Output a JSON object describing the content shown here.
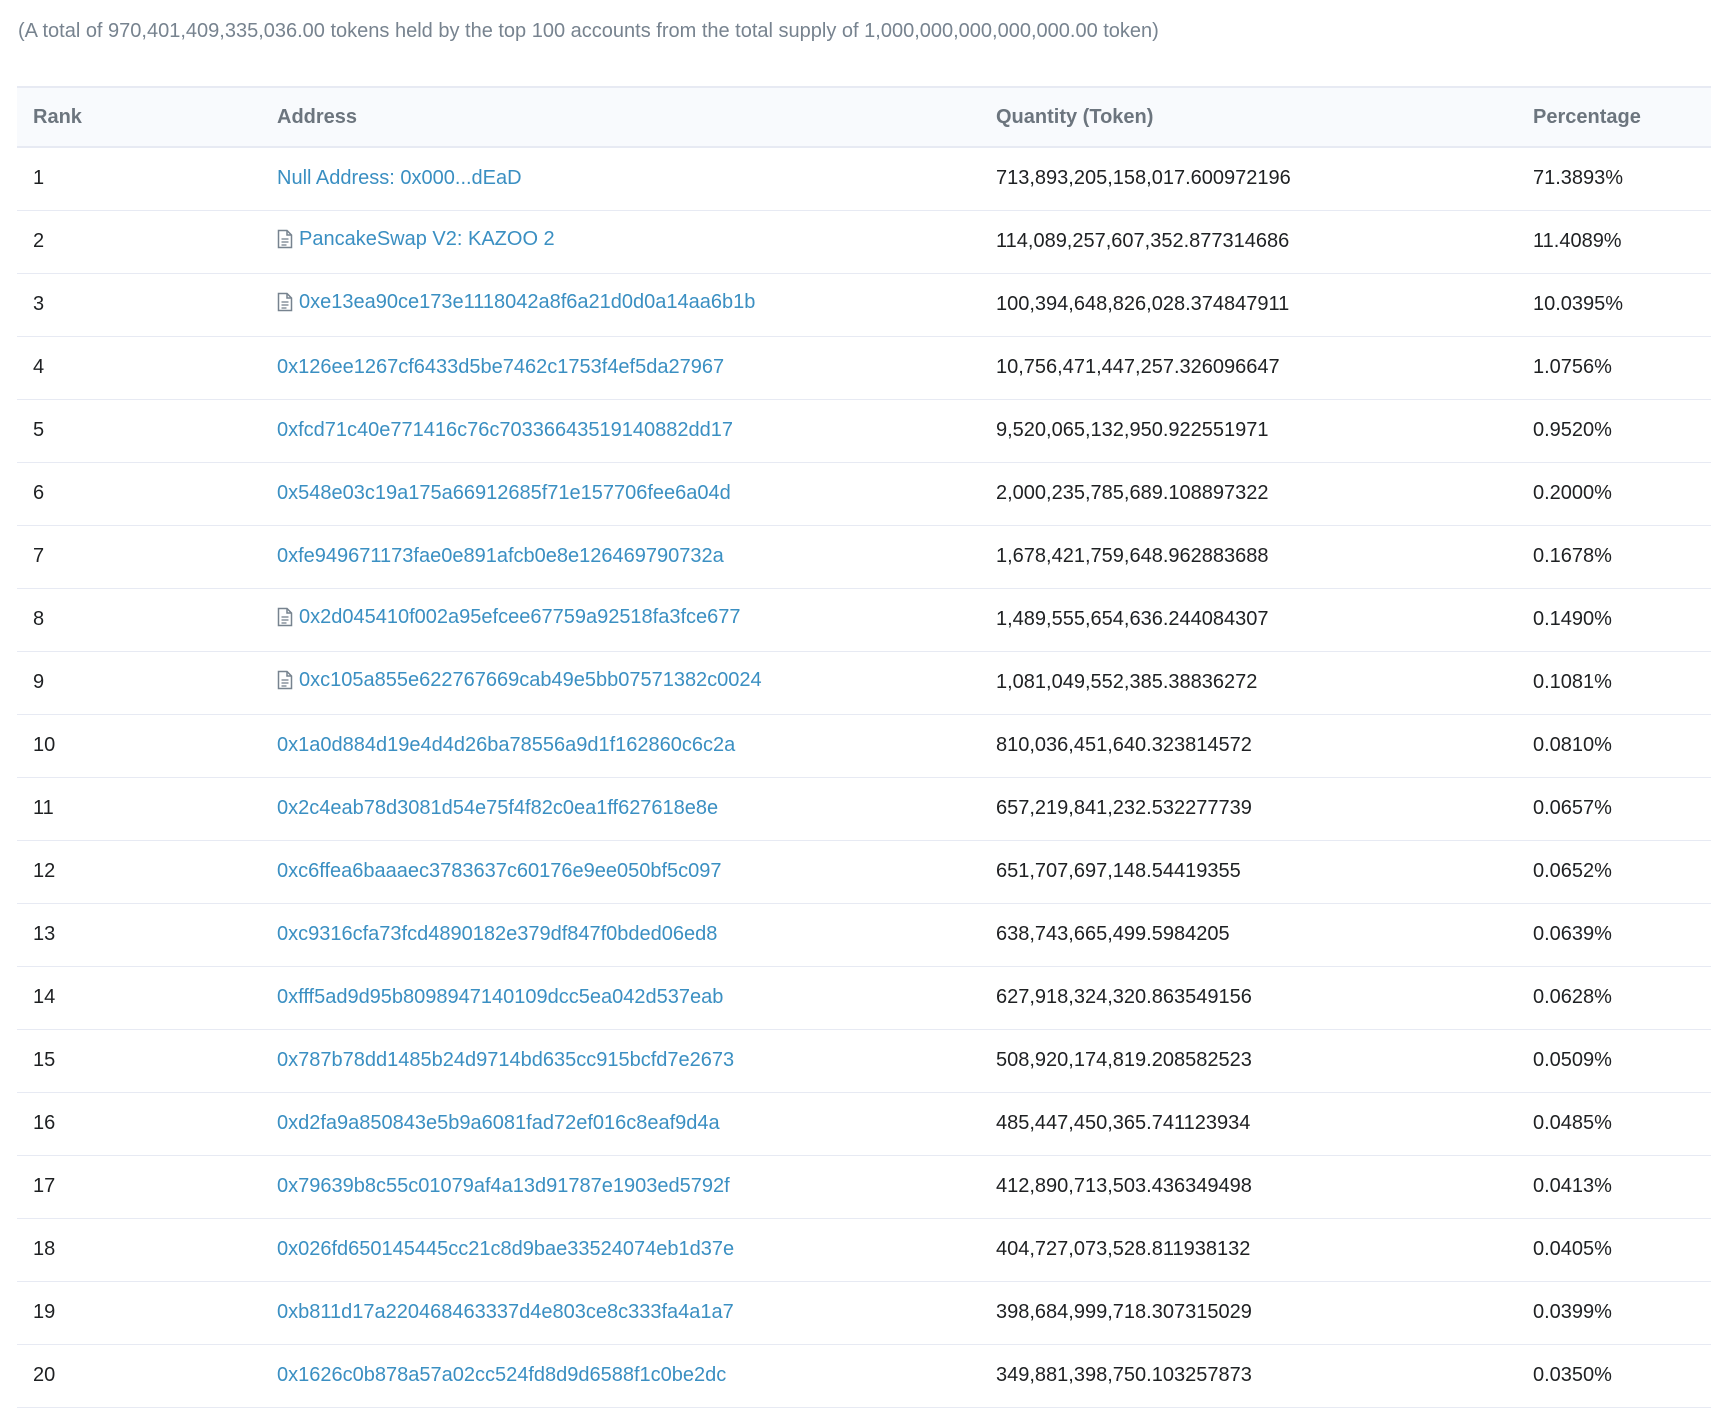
{
  "summary": "(A total of 970,401,409,335,036.00 tokens held by the top 100 accounts from the total supply of 1,000,000,000,000,000.00 token)",
  "table": {
    "headers": {
      "rank": "Rank",
      "address": "Address",
      "quantity": "Quantity (Token)",
      "percentage": "Percentage"
    },
    "rows": [
      {
        "rank": "1",
        "address": "Null Address: 0x000...dEaD",
        "contract": false,
        "quantity": "713,893,205,158,017.600972196",
        "percentage": "71.3893%"
      },
      {
        "rank": "2",
        "address": "PancakeSwap V2: KAZOO 2",
        "contract": true,
        "quantity": "114,089,257,607,352.877314686",
        "percentage": "11.4089%"
      },
      {
        "rank": "3",
        "address": "0xe13ea90ce173e1118042a8f6a21d0d0a14aa6b1b",
        "contract": true,
        "quantity": "100,394,648,826,028.374847911",
        "percentage": "10.0395%"
      },
      {
        "rank": "4",
        "address": "0x126ee1267cf6433d5be7462c1753f4ef5da27967",
        "contract": false,
        "quantity": "10,756,471,447,257.326096647",
        "percentage": "1.0756%"
      },
      {
        "rank": "5",
        "address": "0xfcd71c40e771416c76c70336643519140882dd17",
        "contract": false,
        "quantity": "9,520,065,132,950.922551971",
        "percentage": "0.9520%"
      },
      {
        "rank": "6",
        "address": "0x548e03c19a175a66912685f71e157706fee6a04d",
        "contract": false,
        "quantity": "2,000,235,785,689.108897322",
        "percentage": "0.2000%"
      },
      {
        "rank": "7",
        "address": "0xfe949671173fae0e891afcb0e8e126469790732a",
        "contract": false,
        "quantity": "1,678,421,759,648.962883688",
        "percentage": "0.1678%"
      },
      {
        "rank": "8",
        "address": "0x2d045410f002a95efcee67759a92518fa3fce677",
        "contract": true,
        "quantity": "1,489,555,654,636.244084307",
        "percentage": "0.1490%"
      },
      {
        "rank": "9",
        "address": "0xc105a855e622767669cab49e5bb07571382c0024",
        "contract": true,
        "quantity": "1,081,049,552,385.38836272",
        "percentage": "0.1081%"
      },
      {
        "rank": "10",
        "address": "0x1a0d884d19e4d4d26ba78556a9d1f162860c6c2a",
        "contract": false,
        "quantity": "810,036,451,640.323814572",
        "percentage": "0.0810%"
      },
      {
        "rank": "11",
        "address": "0x2c4eab78d3081d54e75f4f82c0ea1ff627618e8e",
        "contract": false,
        "quantity": "657,219,841,232.532277739",
        "percentage": "0.0657%"
      },
      {
        "rank": "12",
        "address": "0xc6ffea6baaaec3783637c60176e9ee050bf5c097",
        "contract": false,
        "quantity": "651,707,697,148.54419355",
        "percentage": "0.0652%"
      },
      {
        "rank": "13",
        "address": "0xc9316cfa73fcd4890182e379df847f0bded06ed8",
        "contract": false,
        "quantity": "638,743,665,499.5984205",
        "percentage": "0.0639%"
      },
      {
        "rank": "14",
        "address": "0xfff5ad9d95b8098947140109dcc5ea042d537eab",
        "contract": false,
        "quantity": "627,918,324,320.863549156",
        "percentage": "0.0628%"
      },
      {
        "rank": "15",
        "address": "0x787b78dd1485b24d9714bd635cc915bcfd7e2673",
        "contract": false,
        "quantity": "508,920,174,819.208582523",
        "percentage": "0.0509%"
      },
      {
        "rank": "16",
        "address": "0xd2fa9a850843e5b9a6081fad72ef016c8eaf9d4a",
        "contract": false,
        "quantity": "485,447,450,365.741123934",
        "percentage": "0.0485%"
      },
      {
        "rank": "17",
        "address": "0x79639b8c55c01079af4a13d91787e1903ed5792f",
        "contract": false,
        "quantity": "412,890,713,503.436349498",
        "percentage": "0.0413%"
      },
      {
        "rank": "18",
        "address": "0x026fd650145445cc21c8d9bae33524074eb1d37e",
        "contract": false,
        "quantity": "404,727,073,528.811938132",
        "percentage": "0.0405%"
      },
      {
        "rank": "19",
        "address": "0xb811d17a220468463337d4e803ce8c333fa4a1a7",
        "contract": false,
        "quantity": "398,684,999,718.307315029",
        "percentage": "0.0399%"
      },
      {
        "rank": "20",
        "address": "0x1626c0b878a57a02cc524fd8d9d6588f1c0be2dc",
        "contract": false,
        "quantity": "349,881,398,750.103257873",
        "percentage": "0.0350%"
      }
    ]
  },
  "colors": {
    "link": "#3a8fc2",
    "muted": "#77838f",
    "header_bg": "#f8fafd",
    "border": "#e7eaf3"
  },
  "icons": {
    "contract": "document-icon"
  }
}
